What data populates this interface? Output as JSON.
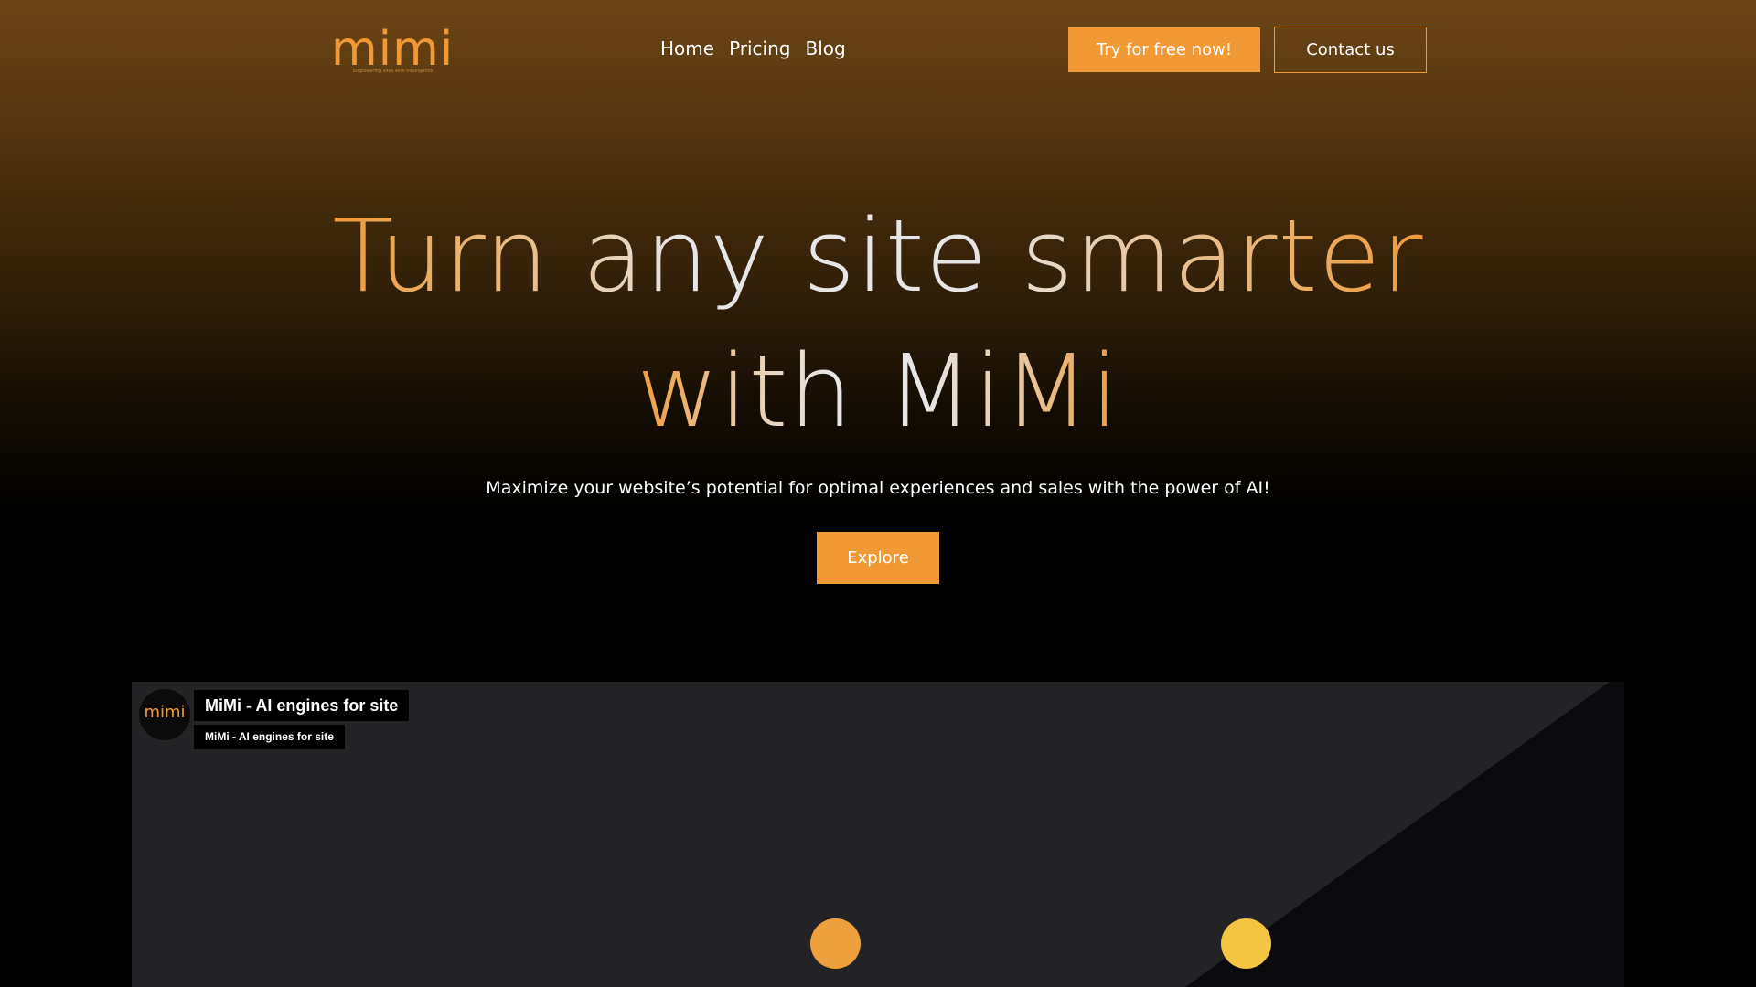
{
  "brand": {
    "logo_text": "mimi",
    "tagline": "Empowering sites with Intelligence",
    "accent_color": "#f19a35"
  },
  "nav": {
    "items": [
      {
        "label": "Home"
      },
      {
        "label": "Pricing"
      },
      {
        "label": "Blog"
      }
    ]
  },
  "header_actions": {
    "try_label": "Try for free now!",
    "contact_label": "Contact us"
  },
  "hero": {
    "headline_line1": "Turn any site smarter",
    "headline_line2": "with MiMi",
    "subtitle": "Maximize your website’s potential for optimal experiences and sales with the power of AI!",
    "cta_label": "Explore"
  },
  "video": {
    "avatar_text": "mimi",
    "title": "MiMi - AI engines for site",
    "channel": "MiMi - AI engines for site",
    "dot_colors": [
      "#eda03c",
      "#f4c443"
    ]
  }
}
